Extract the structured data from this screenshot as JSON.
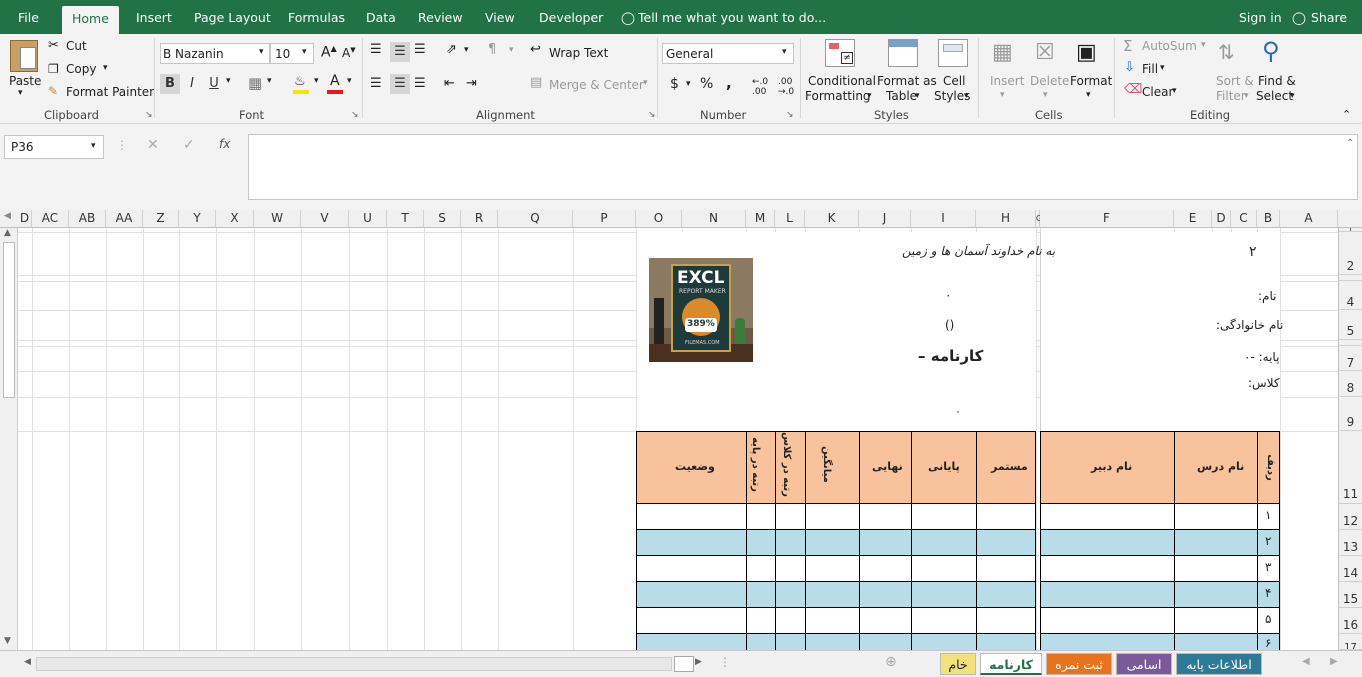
{
  "menu": {
    "file": "File",
    "tabs": [
      "Home",
      "Insert",
      "Page Layout",
      "Formulas",
      "Data",
      "Review",
      "View",
      "Developer"
    ],
    "tell_me": "Tell me what you want to do...",
    "sign_in": "Sign in",
    "share": "Share"
  },
  "ribbon": {
    "clipboard": {
      "paste": "Paste",
      "cut": "Cut",
      "copy": "Copy",
      "format_painter": "Format Painter",
      "label": "Clipboard"
    },
    "font": {
      "name": "B Nazanin",
      "size": "10",
      "bold": "B",
      "italic": "I",
      "underline": "U",
      "label": "Font"
    },
    "alignment": {
      "wrap_text": "Wrap Text",
      "merge_center": "Merge & Center",
      "label": "Alignment"
    },
    "number": {
      "format": "General",
      "currency": "$",
      "percent": "%",
      "comma": ",",
      "label": "Number"
    },
    "styles": {
      "conditional": "Conditional",
      "formatting": "Formatting",
      "format_as": "Format as",
      "table": "Table",
      "cell": "Cell",
      "cell_styles": "Styles",
      "label": "Styles"
    },
    "cells": {
      "insert": "Insert",
      "delete": "Delete",
      "format": "Format",
      "label": "Cells"
    },
    "editing": {
      "autosum": "AutoSum",
      "fill": "Fill",
      "clear": "Clear",
      "sort": "Sort &",
      "filter": "Filter",
      "find": "Find &",
      "select": "Select",
      "label": "Editing"
    }
  },
  "formula_bar": {
    "name_box": "P36",
    "fx": "fx",
    "value": ""
  },
  "columns": [
    "D",
    "AC",
    "AB",
    "AA",
    "Z",
    "Y",
    "X",
    "W",
    "V",
    "U",
    "T",
    "S",
    "R",
    "Q",
    "P",
    "O",
    "N",
    "M",
    "L",
    "K",
    "J",
    "I",
    "H",
    "G",
    "F",
    "E",
    "D",
    "C",
    "B",
    "A"
  ],
  "rows": [
    "1",
    "2",
    "4",
    "5",
    "7",
    "8",
    "9",
    "11",
    "12",
    "13",
    "14",
    "15",
    "16",
    "17"
  ],
  "sheet": {
    "b2_value": "٢",
    "basmala": "به نام خداوند آسمان ها و زمین",
    "name_label": "نام:",
    "name_value": "٠",
    "family_label": "نام خانوادگی:",
    "family_value": "()",
    "grade_label": "پایه: -٠",
    "report_title": "کارنامه –",
    "class_label": "کلاس:",
    "row9_value": "٠",
    "logo_text": "EXCL",
    "logo_sub": "REPORT MAKER",
    "logo_pct": "389%",
    "logo_site": "FILEMAS.COM",
    "table_headers": {
      "radif": "ردیف",
      "dars": "نام درس",
      "dabir": "نام دبیر",
      "mostamar": "مستمر",
      "payani": "پایانی",
      "nahaei": "نهایی",
      "miangin": "میانگین",
      "rotbe_class": "رتبه در کلاس",
      "rotbe_paye": "رتبه در پایه",
      "vaziat": "وضعیت"
    },
    "row_numbers": [
      "١",
      "٢",
      "٣",
      "۴",
      "۵",
      "۶"
    ]
  },
  "sheet_tabs": [
    {
      "label": "خام",
      "color": "#f3e27a"
    },
    {
      "label": "کارنامه",
      "color": "#ffffff"
    },
    {
      "label": "ثبت نمره",
      "color": "#e8731d"
    },
    {
      "label": "اسامی",
      "color": "#7a5a9a"
    },
    {
      "label": "اطلاعات پایه",
      "color": "#2e7a96"
    }
  ]
}
